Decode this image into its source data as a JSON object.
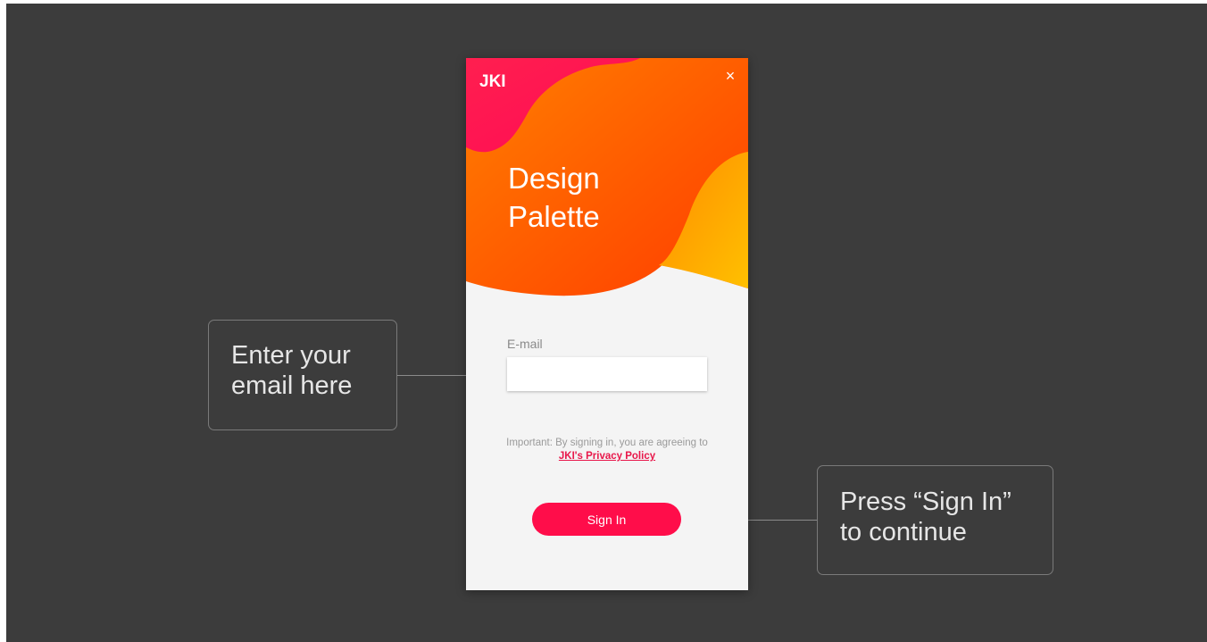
{
  "dialog": {
    "logo": "JKI",
    "close_label": "×",
    "title_line1": "Design",
    "title_line2": "Palette",
    "email_label": "E-mail",
    "email_value": "",
    "email_placeholder": "",
    "notice_text": "Important: By signing in, you are agreeing to ",
    "privacy_link": "JKI's Privacy Policy",
    "signin_label": "Sign In"
  },
  "callouts": {
    "left_line1": "Enter your",
    "left_line2": "email here",
    "right_line1": "Press “Sign In”",
    "right_line2": "to continue"
  },
  "colors": {
    "background": "#3c3c3c",
    "accent": "#ff0d4a",
    "hero_orange": "#ff6a00",
    "hero_yellow": "#ffc000",
    "dialog_body": "#f4f4f4"
  },
  "icons": {
    "close": "close-icon"
  }
}
